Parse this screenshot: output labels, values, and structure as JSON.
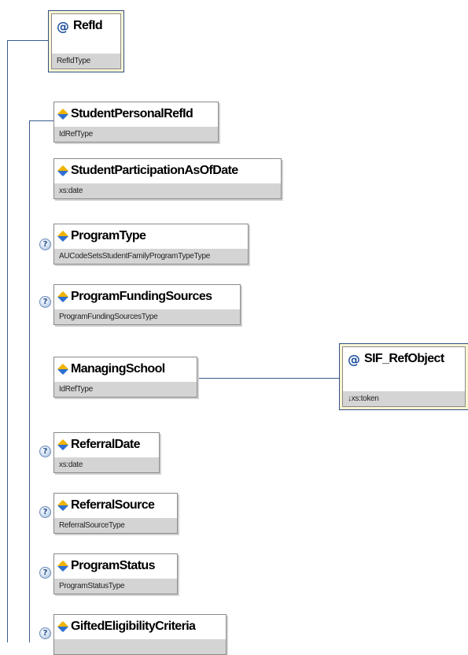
{
  "nodes": {
    "refid": {
      "name": "RefId",
      "type": "RefIdType",
      "kind": "attribute"
    },
    "student_personal_refid": {
      "name": "StudentPersonalRefId",
      "type": "IdRefType",
      "kind": "element"
    },
    "student_participation_as_of_date": {
      "name": "StudentParticipationAsOfDate",
      "type": "xs:date",
      "kind": "element"
    },
    "program_type": {
      "name": "ProgramType",
      "type": "AUCodeSetsStudentFamilyProgramTypeType",
      "kind": "element",
      "optional": true
    },
    "program_funding_sources": {
      "name": "ProgramFundingSources",
      "type": "ProgramFundingSourcesType",
      "kind": "element",
      "optional": true
    },
    "managing_school": {
      "name": "ManagingSchool",
      "type": "IdRefType",
      "kind": "element"
    },
    "sif_refobject": {
      "name": "SIF_RefObject",
      "type": "↓xs:token",
      "kind": "attribute"
    },
    "referral_date": {
      "name": "ReferralDate",
      "type": "xs:date",
      "kind": "element",
      "optional": true
    },
    "referral_source": {
      "name": "ReferralSource",
      "type": "ReferralSourceType",
      "kind": "element",
      "optional": true
    },
    "program_status": {
      "name": "ProgramStatus",
      "type": "ProgramStatusType",
      "kind": "element",
      "optional": true
    },
    "gifted_eligibility_criteria": {
      "name": "GiftedEligibilityCriteria",
      "type": "",
      "kind": "element",
      "optional": true
    }
  },
  "icons": {
    "element": "element-diamond-icon",
    "attribute": "attribute-at-icon",
    "optional": "optional-question-icon"
  },
  "glyphs": {
    "attribute": "@",
    "optional": "?"
  },
  "colors": {
    "connector": "#3a5a8c",
    "attribute_frame": "#2d4f86",
    "attribute_fill": "#fbf6d2",
    "type_band": "#d4d4d4"
  }
}
